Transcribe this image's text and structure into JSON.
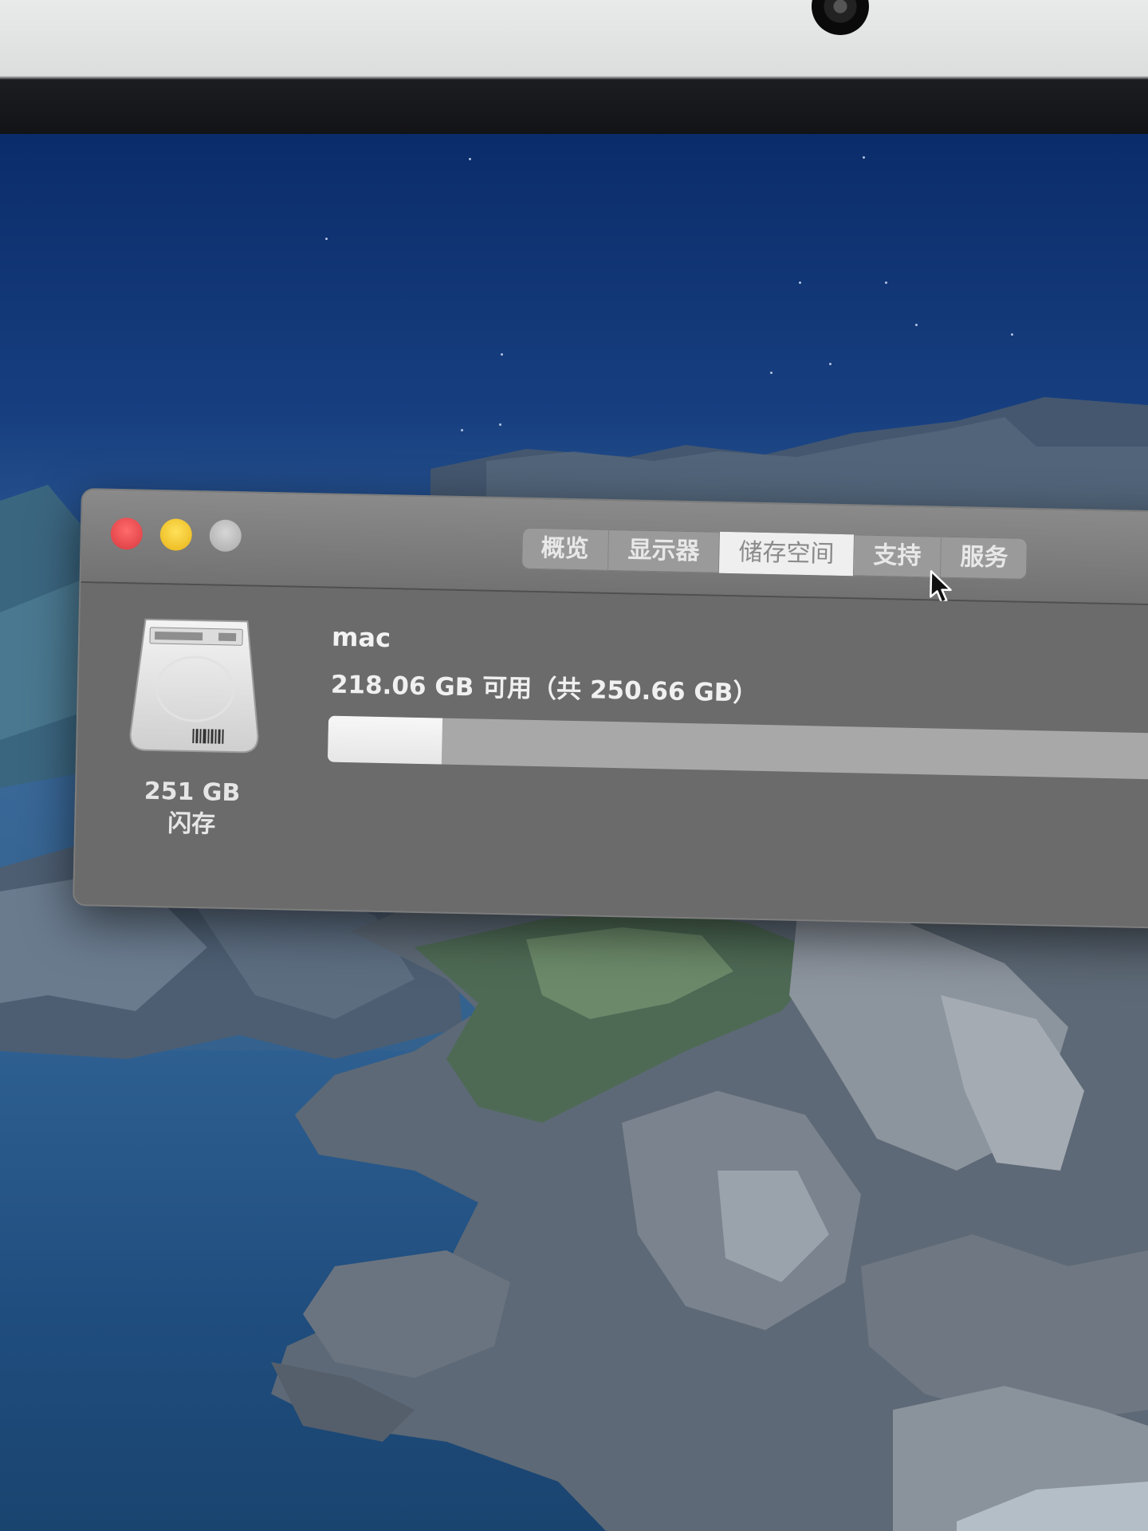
{
  "window": {
    "tabs": [
      {
        "label": "概览"
      },
      {
        "label": "显示器"
      },
      {
        "label": "储存空间",
        "active": true
      },
      {
        "label": "支持"
      },
      {
        "label": "服务"
      }
    ]
  },
  "storage": {
    "disk_size": "251 GB",
    "disk_type": "闪存",
    "volume_name": "mac",
    "summary": "218.06 GB 可用（共 250.66 GB）",
    "used_fraction": 0.13
  },
  "icons": [
    "close-button",
    "minimize-button",
    "zoom-button",
    "hard-drive-icon",
    "mouse-cursor-icon"
  ],
  "colors": {
    "close": "#ec4a4f",
    "minimize": "#f3c624",
    "zoom": "#c0c0c0",
    "window_bg": "#6b6b6b",
    "bar_used": "#f2f2f2",
    "bar_free": "#a8a8a8"
  }
}
